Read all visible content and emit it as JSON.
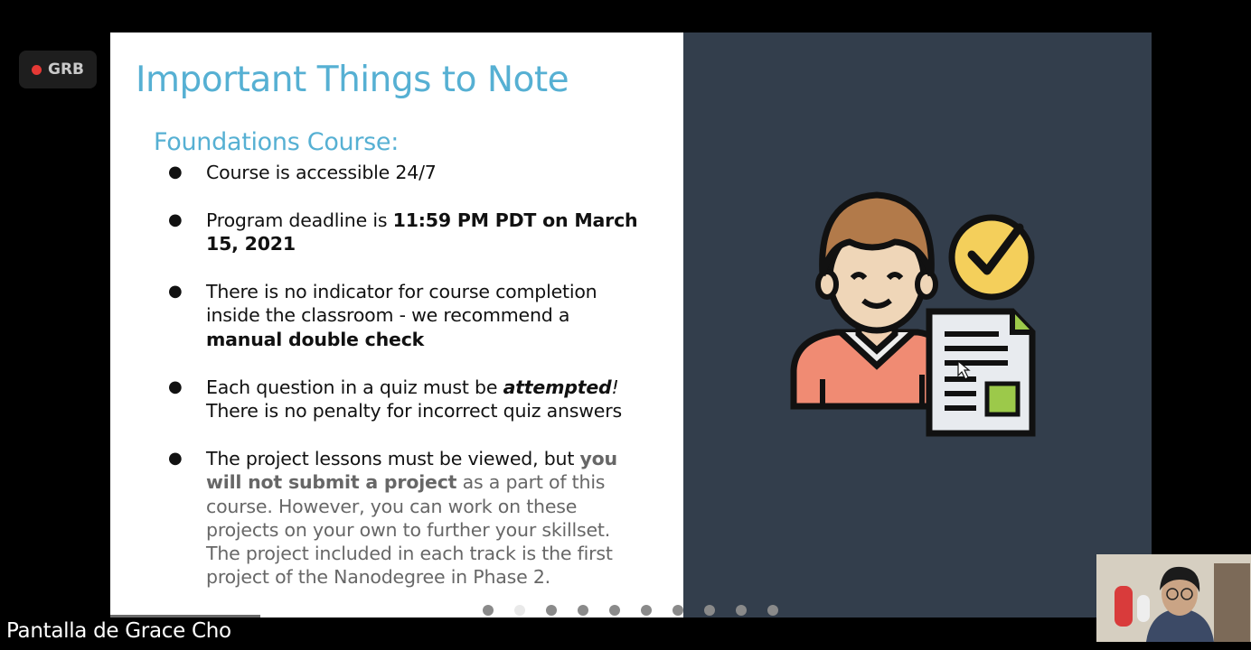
{
  "recording_badge": {
    "label": "GRB"
  },
  "slide": {
    "title": "Important Things to Note",
    "subtitle": "Foundations Course:",
    "bullets": [
      {
        "t1": "Course is accessible 24/7"
      },
      {
        "t1": "Program deadline is ",
        "b1": "11:59 PM PDT on March",
        "b2": "15, 2021"
      },
      {
        "t1": "There is no indicator for course completion",
        "t2": "inside the classroom - we recommend a",
        "b1": "manual double check"
      },
      {
        "t1": "Each question in a quiz must be ",
        "bi": "attempted",
        "t1b": "!",
        "t2": "There is no penalty for incorrect quiz answers"
      },
      {
        "t1": "The project lessons must be viewed, but ",
        "b1": "you",
        "b2": "will not submit a project",
        "t2": " as a part of this",
        "l3": "course. However, you can work on these",
        "l4": "projects on your own to further your skillset.",
        "l5": "The project included in each track is the first",
        "l6": "project of the Nanodegree in Phase 2."
      }
    ],
    "pagination": {
      "total": 10,
      "active_index": 1
    }
  },
  "screen_share_label": "Pantalla de Grace Cho",
  "colors": {
    "title": "#56b0d3",
    "right_panel": "#333e4c",
    "record_dot": "#e53935"
  }
}
